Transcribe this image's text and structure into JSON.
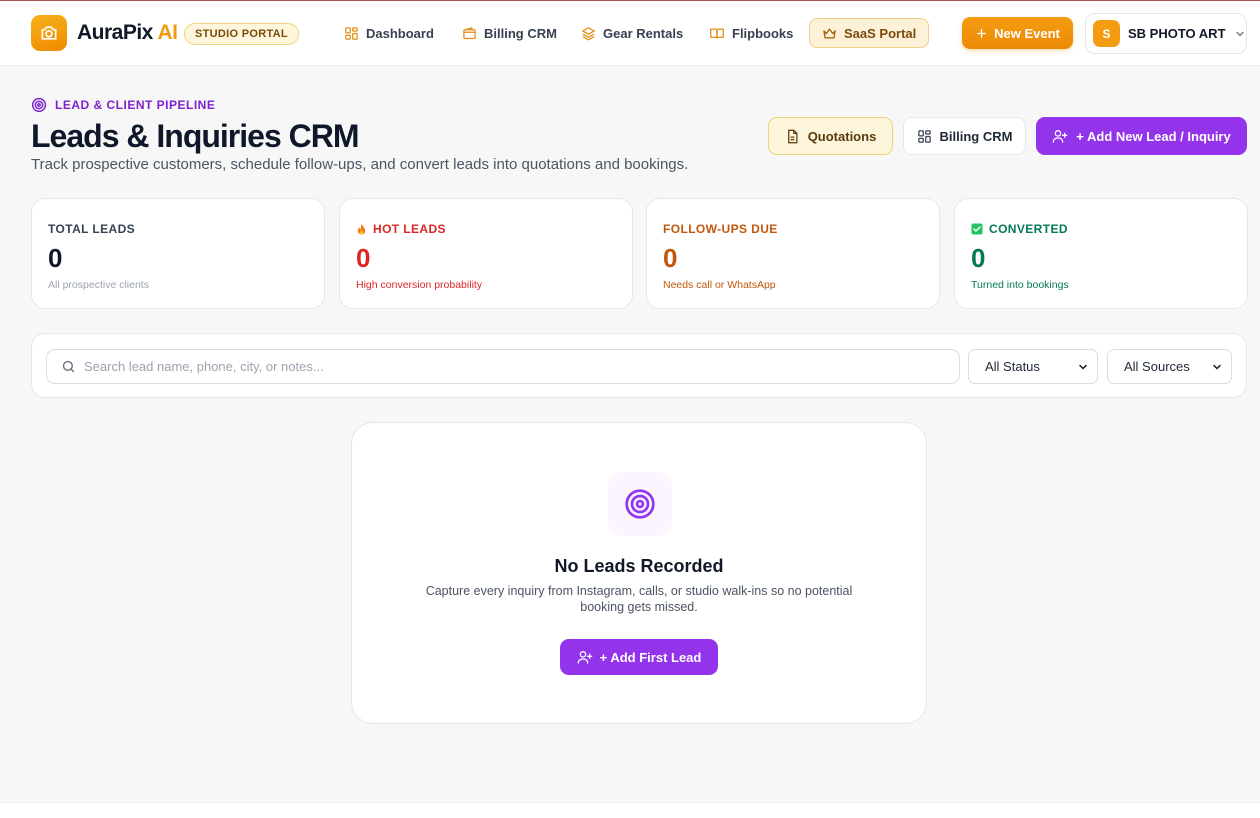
{
  "header": {
    "brand_name": "AuraPix",
    "brand_suffix": "AI",
    "portal_badge": "STUDIO PORTAL",
    "nav": [
      {
        "label": "Dashboard",
        "icon": "dashboard-grid-icon"
      },
      {
        "label": "Billing CRM",
        "icon": "wallet-icon"
      },
      {
        "label": "Gear Rentals",
        "icon": "layers-icon"
      },
      {
        "label": "Flipbooks",
        "icon": "book-open-icon"
      },
      {
        "label": "SaaS Portal",
        "icon": "crown-icon"
      }
    ],
    "new_event_label": "New Event",
    "account": {
      "avatar_letter": "S",
      "name": "SB PHOTO ART"
    }
  },
  "page": {
    "eyebrow": "LEAD & CLIENT PIPELINE",
    "title": "Leads & Inquiries CRM",
    "subtitle": "Track prospective customers, schedule follow-ups, and convert leads into quotations and bookings.",
    "actions": {
      "quotations": "Quotations",
      "billing": "Billing CRM",
      "add_lead": "+ Add New Lead / Inquiry"
    }
  },
  "stats": [
    {
      "label": "TOTAL LEADS",
      "value": "0",
      "note": "All prospective clients",
      "color": "#0f172a"
    },
    {
      "label": "HOT LEADS",
      "value": "0",
      "note": "High conversion probability",
      "color": "#dc2626"
    },
    {
      "label": "FOLLOW-UPS DUE",
      "value": "0",
      "note": "Needs call or WhatsApp",
      "color": "#c2570c"
    },
    {
      "label": "CONVERTED",
      "value": "0",
      "note": "Turned into bookings",
      "color": "#047857"
    }
  ],
  "filters": {
    "search_placeholder": "Search lead name, phone, city, or notes...",
    "status_selected": "All Status",
    "source_selected": "All Sources"
  },
  "empty_state": {
    "title": "No Leads Recorded",
    "description": "Capture every inquiry from Instagram, calls, or studio walk-ins so no potential booking gets missed.",
    "button_label": "+ Add First Lead"
  },
  "colors": {
    "brand_orange": "#f39c12",
    "accent_purple": "#9333ea"
  }
}
